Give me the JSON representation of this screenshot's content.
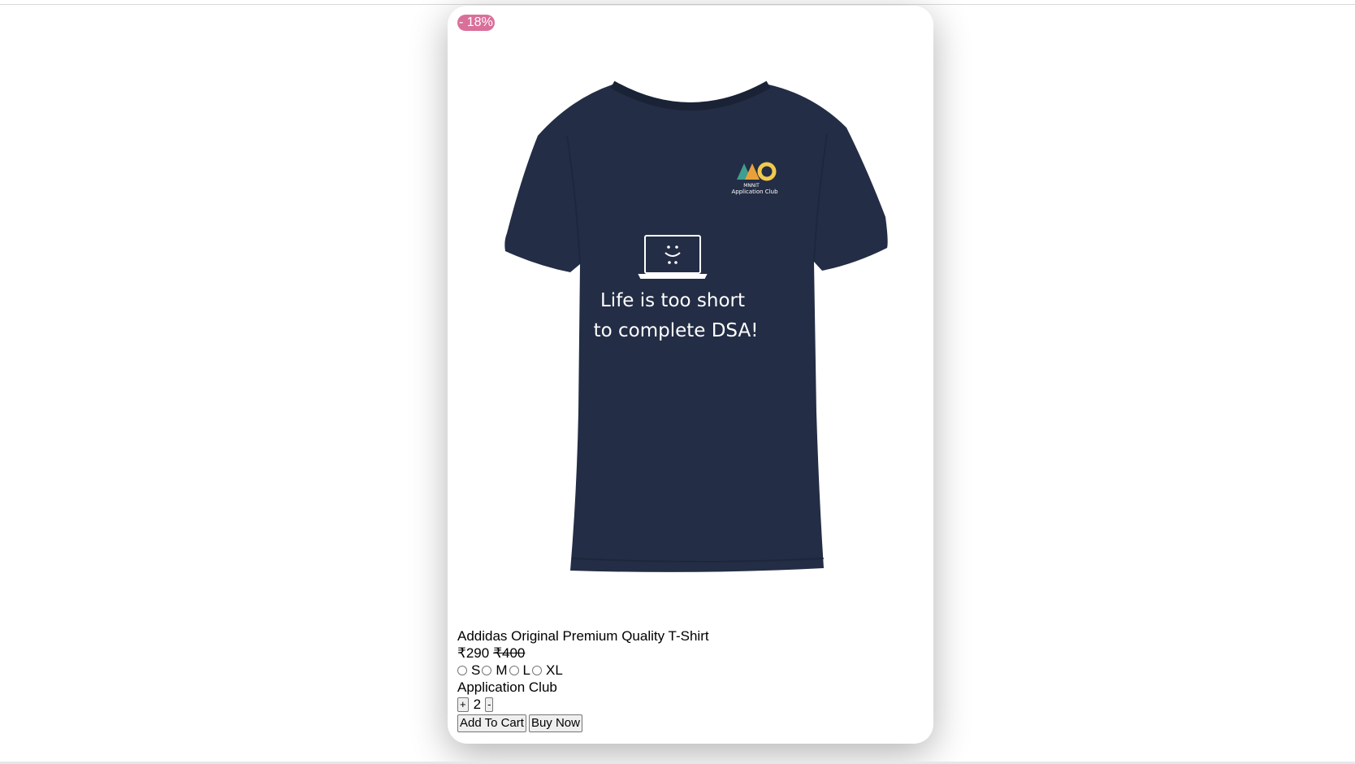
{
  "product": {
    "discount_badge": "- 18%",
    "print_text_line1": "Life is too short",
    "print_text_line2": "to complete DSA!",
    "logo_text_line1": "MNNIT",
    "logo_text_line2": "Application Club",
    "title": "Addidas Original Premium Quality T-Shirt",
    "price_current": "₹290",
    "price_original": "₹400",
    "sizes": [
      "S",
      "M",
      "L",
      "XL"
    ],
    "seller": "Application Club",
    "quantity": {
      "increment_label": "+",
      "value": "2",
      "decrement_label": "-"
    },
    "actions": {
      "add_to_cart": "Add To Cart",
      "buy_now": "Buy Now"
    },
    "colors": {
      "badge": "#d9709a",
      "shirt": "#232d45",
      "print": "#ffffff"
    }
  }
}
